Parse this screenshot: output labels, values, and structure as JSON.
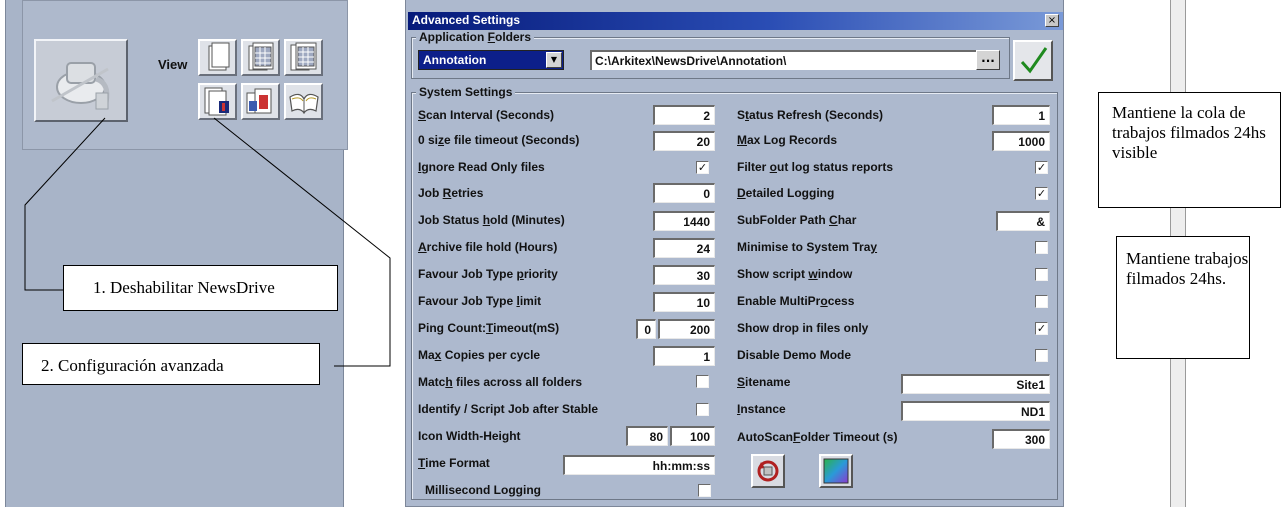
{
  "left_panel": {
    "view_label": "View",
    "icons": [
      "disable-newsdrive-icon",
      "view-blank-page-icon",
      "view-table-icon",
      "view-table-alt-icon",
      "advanced-config-icon",
      "job-settings-icon",
      "open-book-icon"
    ]
  },
  "callouts": {
    "disable": "1. Deshabilitar NewsDrive",
    "advanced": "2.  Configuración avanzada"
  },
  "notes": {
    "queue_visible": "Mantiene la cola de trabajos filmados 24hs visible",
    "jobs_kept": "Mantiene trabajos filmados 24hs."
  },
  "dialog": {
    "title": "Advanced Settings",
    "close_glyph": "×",
    "app_folders": {
      "group_label_pre": "Application ",
      "group_label_u": "F",
      "group_label_post": "olders",
      "selected_folder": "Annotation",
      "dropdown_glyph": "▼",
      "path": "C:\\Arkitex\\NewsDrive\\Annotation\\",
      "browse_label": "..."
    },
    "system_settings": {
      "group_label": "System Settings",
      "left": {
        "scan_interval": {
          "pre": "",
          "u": "S",
          "post": "can Interval (Seconds)",
          "value": "2"
        },
        "zero_size_timeout": {
          "pre": "0 si",
          "u": "z",
          "post": "e file timeout (Seconds)",
          "value": "20"
        },
        "ignore_read_only": {
          "pre": "",
          "u": "I",
          "post": "gnore Read Only files",
          "checked": "✓"
        },
        "job_retries": {
          "pre": "Job ",
          "u": "R",
          "post": "etries",
          "value": "0"
        },
        "job_status_hold": {
          "pre": "Job Status ",
          "u": "h",
          "post": "old (Minutes)",
          "value": "1440"
        },
        "archive_file_hold": {
          "pre": "",
          "u": "A",
          "post": "rchive file hold (Hours)",
          "value": "24"
        },
        "favour_priority": {
          "pre": "Favour Job Type ",
          "u": "p",
          "post": "riority",
          "value": "30"
        },
        "favour_limit": {
          "pre": "Favour Job Type ",
          "u": "l",
          "post": "imit",
          "value": "10"
        },
        "ping_count": {
          "pre": "Ping Count:",
          "u": "T",
          "post": "imeout(mS)",
          "value1": "0",
          "value2": "200"
        },
        "max_copies": {
          "pre": "Ma",
          "u": "x",
          "post": " Copies per cycle",
          "value": "1"
        },
        "match_files": {
          "pre": "Matc",
          "u": "h",
          "post": " files across all folders",
          "checked": ""
        },
        "identify_script": {
          "pre": "Identify / Script Job after Stable",
          "u": "",
          "post": "",
          "checked": ""
        },
        "icon_width_height": {
          "pre": "Icon Width-Height",
          "u": "",
          "post": "",
          "value1": "80",
          "value2": "100"
        },
        "time_format": {
          "pre": "",
          "u": "T",
          "post": "ime Format",
          "value": "hh:mm:ss"
        },
        "millisecond_logging": {
          "pre": "Millisecond Logging",
          "u": "",
          "post": "",
          "checked": ""
        }
      },
      "right": {
        "status_refresh": {
          "pre": "S",
          "u": "t",
          "post": "atus Refresh (Seconds)",
          "value": "1"
        },
        "max_log_records": {
          "pre": "",
          "u": "M",
          "post": "ax Log Records",
          "value": "1000"
        },
        "filter_log": {
          "pre": "Filter ",
          "u": "o",
          "post": "ut log status reports",
          "checked": "✓"
        },
        "detailed_logging": {
          "pre": "",
          "u": "D",
          "post": "etailed Logging",
          "checked": "✓"
        },
        "subfolder_char": {
          "pre": "SubFolder Path ",
          "u": "C",
          "post": "har",
          "value": "&"
        },
        "minimise_tray": {
          "pre": "Minimise to System Tra",
          "u": "y",
          "post": "",
          "checked": ""
        },
        "show_script": {
          "pre": "Show script ",
          "u": "w",
          "post": "indow",
          "checked": ""
        },
        "enable_multiprocess": {
          "pre": "Enable MultiPr",
          "u": "o",
          "post": "cess",
          "checked": ""
        },
        "show_drop_in": {
          "pre": "Show drop in files only",
          "u": "",
          "post": "",
          "checked": "✓"
        },
        "disable_demo": {
          "pre": "Disable Demo Mode",
          "u": "",
          "post": "",
          "checked": ""
        },
        "sitename": {
          "pre": "",
          "u": "S",
          "post": "itename",
          "value": "Site1"
        },
        "instance": {
          "pre": "",
          "u": "I",
          "post": "nstance",
          "value": "ND1"
        },
        "autoscan_timeout": {
          "pre": "AutoScan",
          "u": "F",
          "post": "older Timeout (s)",
          "value": "300"
        }
      }
    }
  },
  "colors": {
    "panel_bg": "#a8b4c8",
    "dialog_bg": "#adb9ce",
    "title_start": "#061a7a",
    "title_end": "#7a9ad8",
    "selection": "#0c1f8a",
    "ok_check": "#1f8a1f"
  }
}
